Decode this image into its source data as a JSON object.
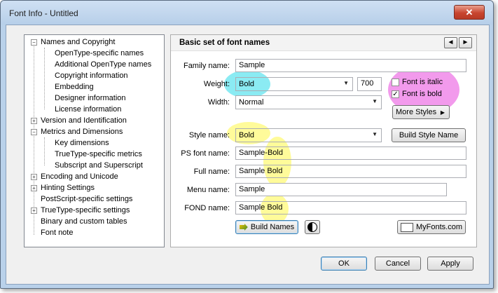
{
  "window": {
    "title": "Font Info - Untitled",
    "close_glyph": "✕"
  },
  "tree": {
    "items": [
      {
        "label": "Names and Copyright",
        "expander": "−",
        "level": 0
      },
      {
        "label": "OpenType-specific names",
        "level": 1
      },
      {
        "label": "Additional OpenType names",
        "level": 1
      },
      {
        "label": "Copyright information",
        "level": 1
      },
      {
        "label": "Embedding",
        "level": 1
      },
      {
        "label": "Designer information",
        "level": 1
      },
      {
        "label": "License information",
        "level": 1
      },
      {
        "label": "Version and Identification",
        "expander": "+",
        "level": 0
      },
      {
        "label": "Metrics and Dimensions",
        "expander": "−",
        "level": 0
      },
      {
        "label": "Key dimensions",
        "level": 1
      },
      {
        "label": "TrueType-specific metrics",
        "level": 1
      },
      {
        "label": "Subscript and Superscript",
        "level": 1
      },
      {
        "label": "Encoding and Unicode",
        "expander": "+",
        "level": 0
      },
      {
        "label": "Hinting Settings",
        "expander": "+",
        "level": 0
      },
      {
        "label": "PostScript-specific settings",
        "level": 0
      },
      {
        "label": "TrueType-specific settings",
        "expander": "+",
        "level": 0
      },
      {
        "label": "Binary and custom tables",
        "level": 0
      },
      {
        "label": "Font note",
        "level": 0
      }
    ]
  },
  "panel": {
    "title": "Basic set of font names",
    "prev_glyph": "◄",
    "next_glyph": "►",
    "family_label": "Family name:",
    "family_value": "Sample",
    "weight_label": "Weight:",
    "weight_value": "Bold",
    "weight_number": "700",
    "width_label": "Width:",
    "width_value": "Normal",
    "italic_label": "Font is italic",
    "italic_checked": false,
    "bold_label": "Font is bold",
    "bold_checked": true,
    "bold_check_glyph": "✓",
    "more_styles_label": "More Styles",
    "more_styles_arrow": "▶",
    "style_label": "Style name:",
    "style_value": "Bold",
    "build_style_label": "Build Style Name",
    "ps_label": "PS font name:",
    "ps_value": "Sample-Bold",
    "full_label": "Full name:",
    "full_value": "Sample Bold",
    "menu_label": "Menu name:",
    "menu_value": "Sample",
    "fond_label": "FOND name:",
    "fond_value": "Sample Bold",
    "build_names_label": "Build Names",
    "myfonts_label": "MyFonts.com",
    "dropdown_arrow": "▼"
  },
  "buttons": {
    "ok": "OK",
    "cancel": "Cancel",
    "apply": "Apply"
  },
  "colors": {
    "highlight_cyan": "#6ee6f0",
    "highlight_yellow": "#fffa78",
    "highlight_pink": "#ee78e6",
    "accent_blue": "#3c7fb1"
  }
}
